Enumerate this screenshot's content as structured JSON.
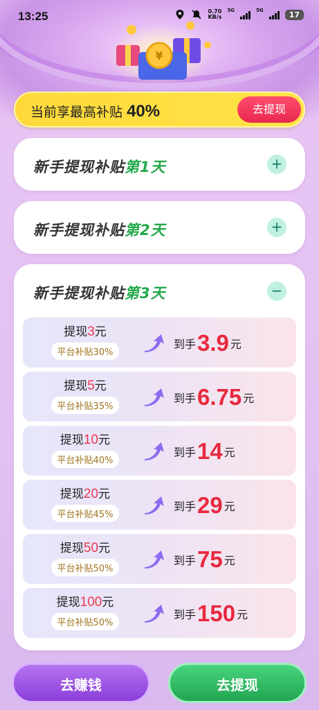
{
  "status_bar": {
    "time": "13:25",
    "net_speed_value": "0.70",
    "net_speed_unit": "KB/s",
    "sig1": "5G",
    "sig2": "5G",
    "battery": "17"
  },
  "subsidy": {
    "label": "当前享最高补贴",
    "value": "40%",
    "button": "去提现"
  },
  "cards": [
    {
      "title": "新手提现补贴",
      "day": "第1天",
      "toggle": "+"
    },
    {
      "title": "新手提现补贴",
      "day": "第2天",
      "toggle": "+"
    },
    {
      "title": "新手提现补贴",
      "day": "第3天",
      "toggle": "−"
    }
  ],
  "rows": [
    {
      "prefix": "提现",
      "amount": "3",
      "unit": "元",
      "rate": "平台补贴30%",
      "receive": "到手",
      "final": "3.9",
      "final_unit": "元"
    },
    {
      "prefix": "提现",
      "amount": "5",
      "unit": "元",
      "rate": "平台补贴35%",
      "receive": "到手",
      "final": "6.75",
      "final_unit": "元"
    },
    {
      "prefix": "提现",
      "amount": "10",
      "unit": "元",
      "rate": "平台补贴40%",
      "receive": "到手",
      "final": "14",
      "final_unit": "元"
    },
    {
      "prefix": "提现",
      "amount": "20",
      "unit": "元",
      "rate": "平台补贴45%",
      "receive": "到手",
      "final": "29",
      "final_unit": "元"
    },
    {
      "prefix": "提现",
      "amount": "50",
      "unit": "元",
      "rate": "平台补贴50%",
      "receive": "到手",
      "final": "75",
      "final_unit": "元"
    },
    {
      "prefix": "提现",
      "amount": "100",
      "unit": "元",
      "rate": "平台补贴50%",
      "receive": "到手",
      "final": "150",
      "final_unit": "元"
    }
  ],
  "bottom": {
    "earn": "去赚钱",
    "withdraw": "去提现"
  },
  "colors": {
    "accent_red": "#e8293f",
    "accent_green": "#22a84a",
    "banner_yellow": "#ffd93a",
    "earn_purple": "#8a3fd9",
    "withdraw_green": "#22a550"
  },
  "icons": [
    "location-icon",
    "mute-icon",
    "arrow-up-icon",
    "plus-icon",
    "minus-icon",
    "gift-icon"
  ]
}
